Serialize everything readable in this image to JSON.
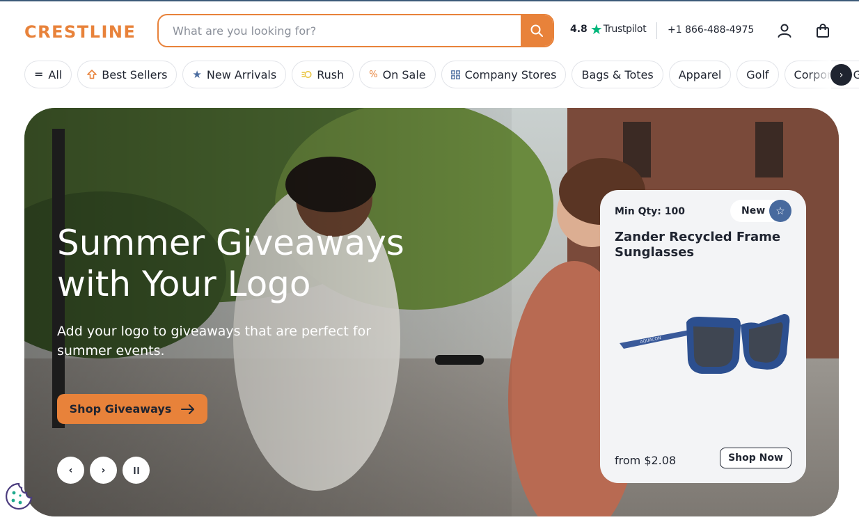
{
  "header": {
    "logo": "CRESTLINE",
    "search": {
      "placeholder": "What are you looking for?"
    },
    "rating": {
      "value": "4.8",
      "brand": "Trustpilot"
    },
    "phone": "+1 866-488-4975"
  },
  "nav": {
    "items": [
      {
        "label": "All",
        "icon": "menu-icon"
      },
      {
        "label": "Best Sellers",
        "icon": "upload-arrow-icon"
      },
      {
        "label": "New Arrivals",
        "icon": "star-icon"
      },
      {
        "label": "Rush",
        "icon": "fast-icon"
      },
      {
        "label": "On Sale",
        "icon": "percent-icon"
      },
      {
        "label": "Company Stores",
        "icon": "grid-icon"
      },
      {
        "label": "Bags & Totes"
      },
      {
        "label": "Apparel"
      },
      {
        "label": "Golf"
      },
      {
        "label": "Corporate Gifts"
      }
    ]
  },
  "hero": {
    "title_line1": "Summer Giveaways",
    "title_line2": "with Your Logo",
    "subtitle": "Add your logo to giveaways that are perfect for summer events.",
    "cta_label": "Shop Giveaways"
  },
  "product_card": {
    "min_qty": "Min Qty: 100",
    "badge": "New",
    "name": "Zander Recycled Frame Sunglasses",
    "imprint": "AQUACON",
    "price": "from $2.08",
    "button": "Shop Now"
  },
  "colors": {
    "accent": "#e8823a",
    "dark": "#1f2430",
    "badge_blue": "#486a9e",
    "trustpilot_green": "#00b67a"
  }
}
